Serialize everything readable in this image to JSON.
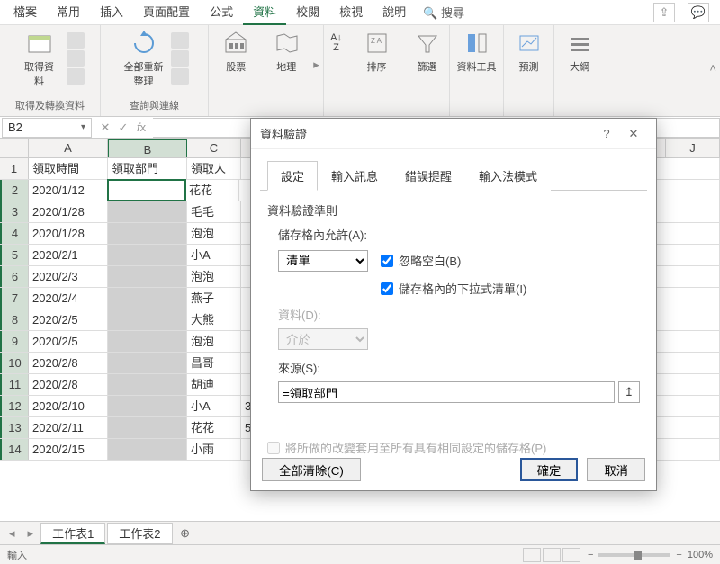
{
  "ribbon_tabs": {
    "file": "檔案",
    "home": "常用",
    "insert": "插入",
    "layout": "頁面配置",
    "formulas": "公式",
    "data": "資料",
    "review": "校閱",
    "view": "檢視",
    "help": "說明",
    "search": "搜尋"
  },
  "ribbon": {
    "group1": {
      "get_data": "取得資\n料",
      "label": "取得及轉換資料"
    },
    "group2": {
      "refresh": "全部重新整理",
      "label": "查詢與連線"
    },
    "group3": {
      "stocks": "股票",
      "geo": "地理"
    },
    "group4": {
      "sort": "排序",
      "filter": "篩選"
    },
    "group5": {
      "tools": "資料工具"
    },
    "group6": {
      "forecast": "預測"
    },
    "group7": {
      "outline": "大綱"
    }
  },
  "namebox": "B2",
  "headers": {
    "A": "A",
    "B": "B",
    "C": "C",
    "J": "J"
  },
  "table": {
    "cols": [
      "領取時間",
      "領取部門",
      "領取人"
    ],
    "rows": [
      {
        "n": 1,
        "a": "領取時間",
        "b": "領取部門",
        "c": "領取人"
      },
      {
        "n": 2,
        "a": "2020/1/12",
        "b": "",
        "c": "花花"
      },
      {
        "n": 3,
        "a": "2020/1/28",
        "b": "",
        "c": "毛毛"
      },
      {
        "n": 4,
        "a": "2020/1/28",
        "b": "",
        "c": "泡泡"
      },
      {
        "n": 5,
        "a": "2020/2/1",
        "b": "",
        "c": "小A"
      },
      {
        "n": 6,
        "a": "2020/2/3",
        "b": "",
        "c": "泡泡"
      },
      {
        "n": 7,
        "a": "2020/2/4",
        "b": "",
        "c": "燕子"
      },
      {
        "n": 8,
        "a": "2020/2/5",
        "b": "",
        "c": "大熊"
      },
      {
        "n": 9,
        "a": "2020/2/5",
        "b": "",
        "c": "泡泡"
      },
      {
        "n": 10,
        "a": "2020/2/8",
        "b": "",
        "c": "昌哥"
      },
      {
        "n": 11,
        "a": "2020/2/8",
        "b": "",
        "c": "胡迪"
      },
      {
        "n": 12,
        "a": "2020/2/10",
        "b": "",
        "c": "小A"
      },
      {
        "n": 13,
        "a": "2020/2/11",
        "b": "",
        "c": "花花"
      },
      {
        "n": 14,
        "a": "2020/2/15",
        "b": "",
        "c": "小雨"
      }
    ],
    "extra": {
      "r12": "3",
      "r13": "5"
    }
  },
  "dialog": {
    "title": "資料驗證",
    "tabs": {
      "settings": "設定",
      "input": "輸入訊息",
      "error": "錯誤提醒",
      "ime": "輸入法模式"
    },
    "criteria": "資料驗證準則",
    "allow_label": "儲存格內允許(A):",
    "allow_value": "清單",
    "ignore_blank": "忽略空白(B)",
    "dropdown": "儲存格內的下拉式清單(I)",
    "data_label": "資料(D):",
    "data_value": "介於",
    "source_label": "來源(S):",
    "source_value": "=領取部門",
    "apply_all": "將所做的改變套用至所有具有相同設定的儲存格(P)",
    "clear_all": "全部清除(C)",
    "ok": "確定",
    "cancel": "取消"
  },
  "sheets": {
    "s1": "工作表1",
    "s2": "工作表2"
  },
  "statusbar": {
    "mode": "輸入",
    "zoom": "100%"
  }
}
